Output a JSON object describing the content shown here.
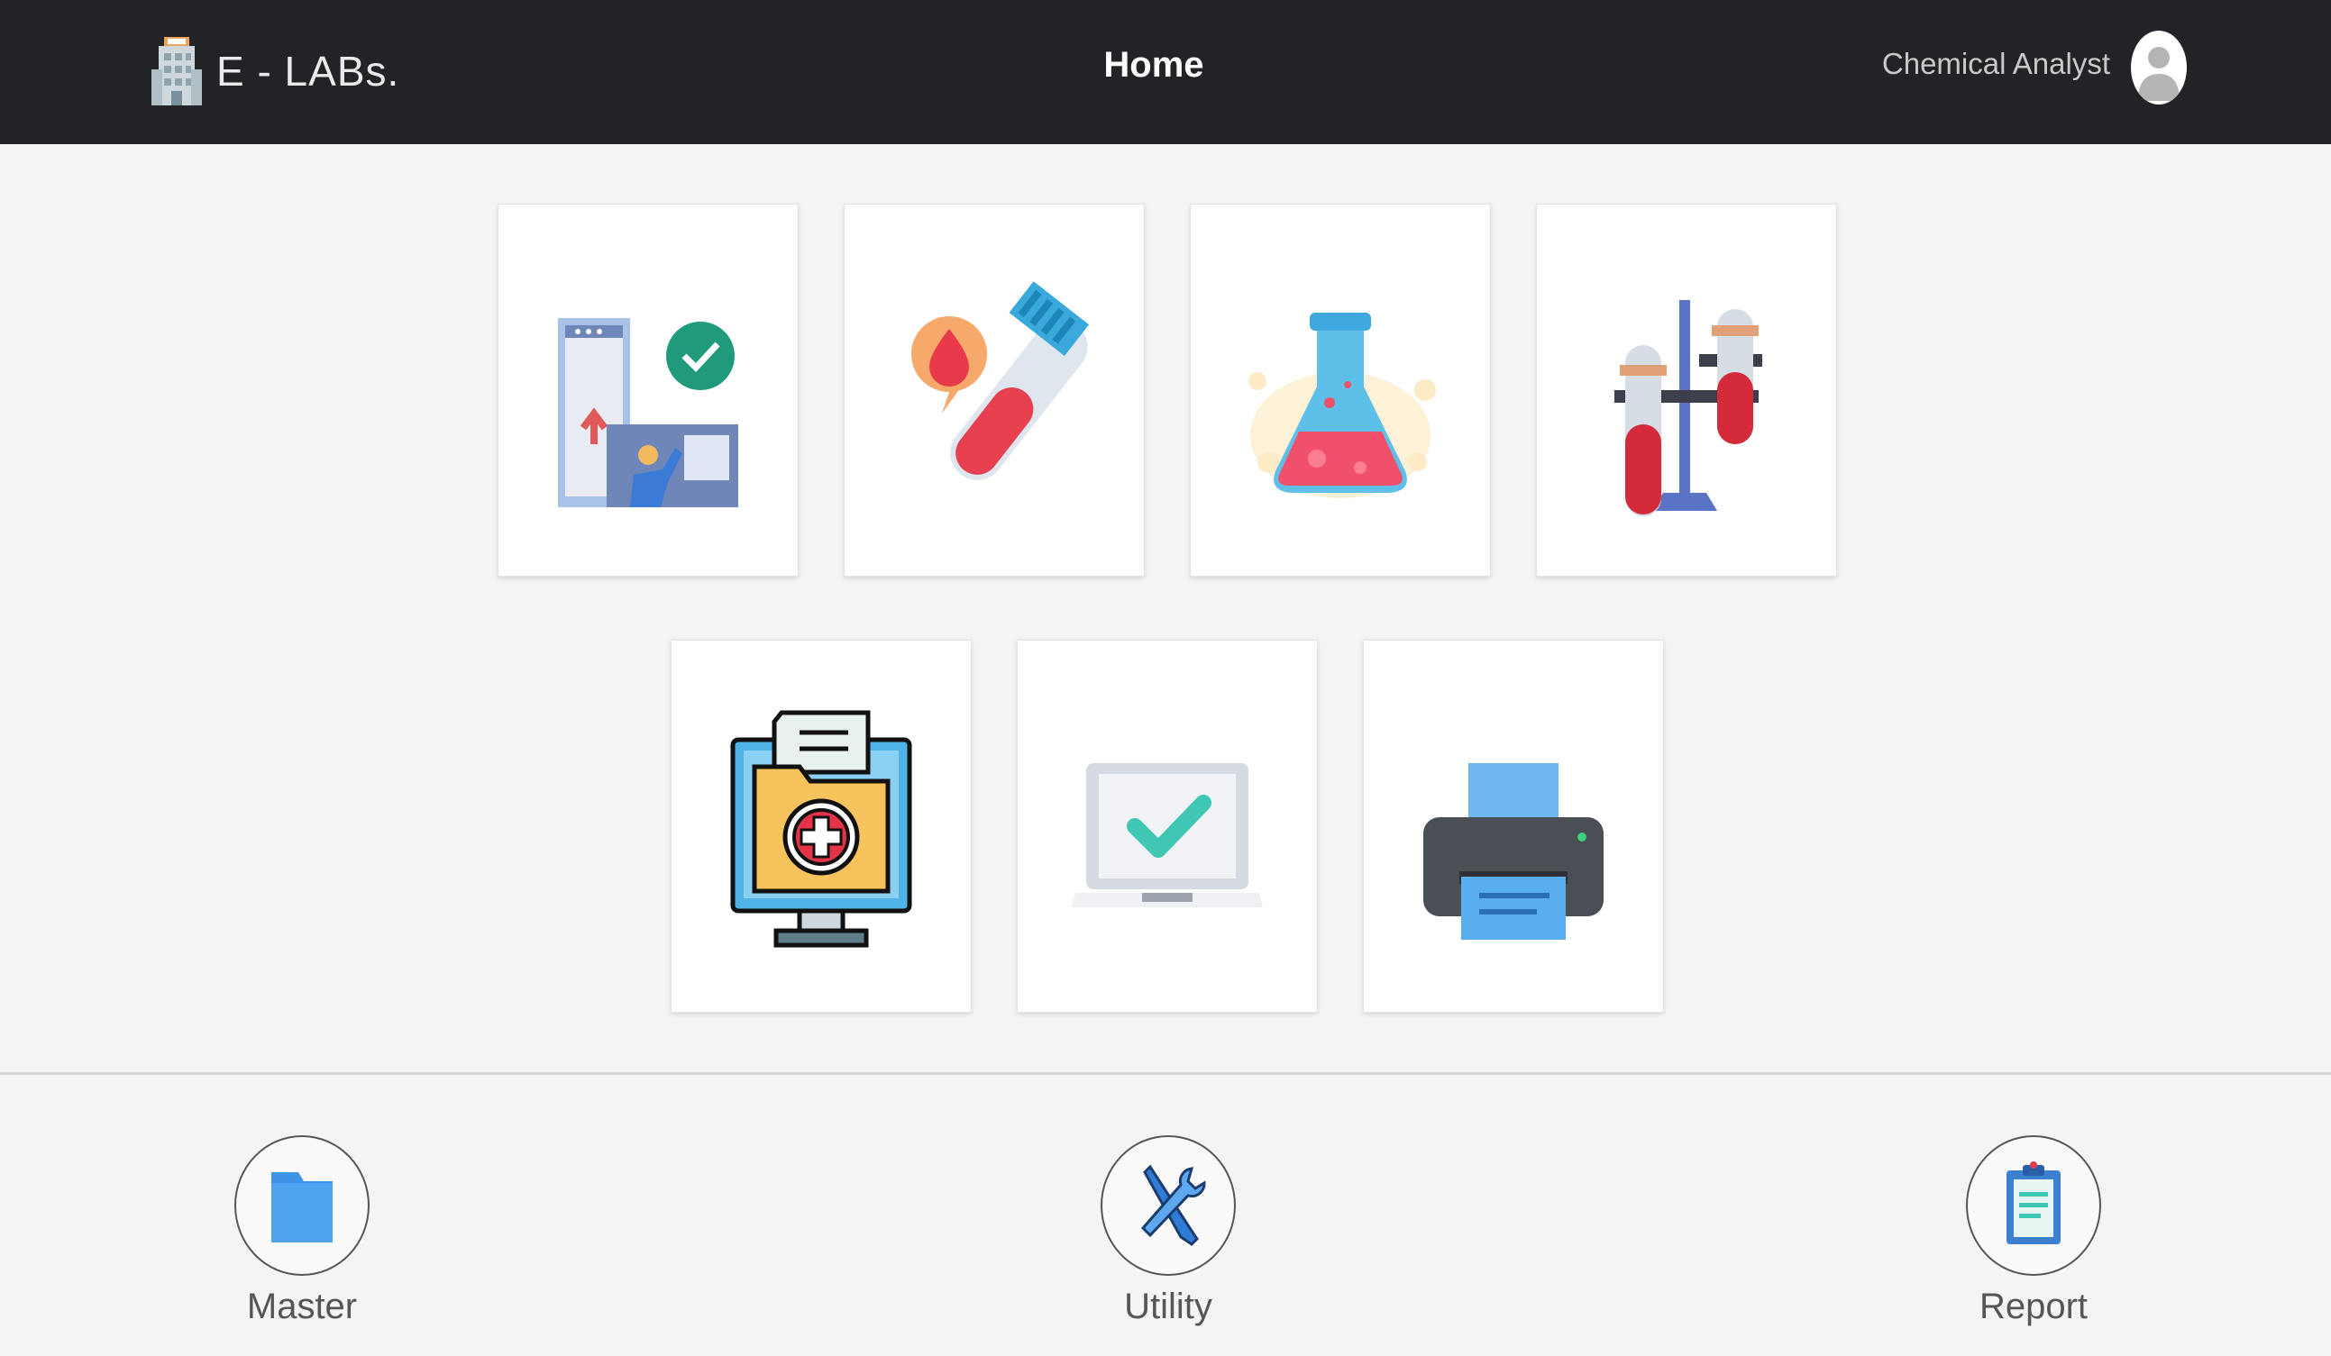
{
  "header": {
    "brand_name": "E - LABs.",
    "brand_icon": "lab-building-icon",
    "page_title": "Home",
    "user_role": "Chemical Analyst",
    "avatar_icon": "user-avatar-icon"
  },
  "tiles": [
    {
      "icon": "approval-dashboard-icon"
    },
    {
      "icon": "blood-sample-tube-icon"
    },
    {
      "icon": "flask-icon"
    },
    {
      "icon": "test-tube-stand-icon"
    },
    {
      "icon": "medical-records-icon"
    },
    {
      "icon": "monitor-check-icon"
    },
    {
      "icon": "printer-icon"
    }
  ],
  "footer": {
    "items": [
      {
        "label": "Master",
        "icon": "folder-icon"
      },
      {
        "label": "Utility",
        "icon": "tools-icon"
      },
      {
        "label": "Report",
        "icon": "clipboard-report-icon"
      }
    ]
  },
  "colors": {
    "header_bg": "#212327",
    "page_bg": "#f4f4f4",
    "tile_bg": "#ffffff"
  }
}
